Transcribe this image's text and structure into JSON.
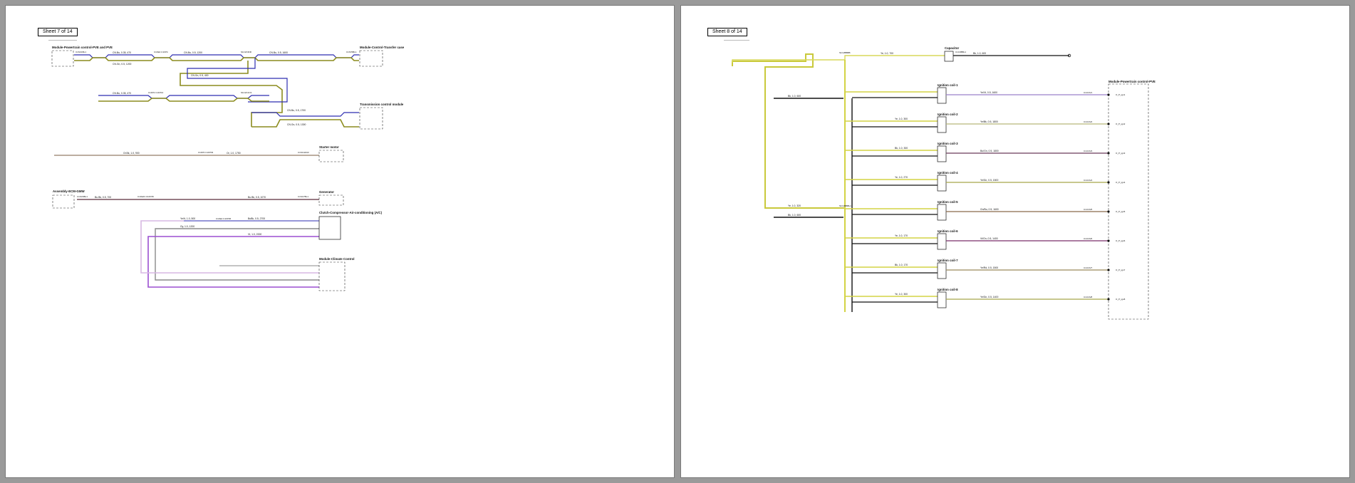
{
  "sheets": [
    {
      "label": "Sheet 7 of 14"
    },
    {
      "label": "Sheet 8 of 14"
    }
  ],
  "sheet7": {
    "components": {
      "pcm": "Module-Powertrain control-PVE and PVE",
      "transfer": "Module-Control-Transfer case",
      "tcm": "Transmission control module",
      "starter": "Starter motor",
      "assembly": "Assembly-ECM-GMW",
      "generator": "Generator",
      "clutch": "Clutch-Compressor-Air-conditioning (A/C)",
      "climate": "Module-Climate Control"
    },
    "wires": {
      "w1": "CN.Bu, 0.35, 470",
      "w2": "CN.Bu, 0.5, 1200",
      "w3": "CN.Bu, 0.5, 1600",
      "w4": "CN.Gn, 0.5, 1200",
      "w5": "CN.Gn, 0.5, 400",
      "w6": "CN.Bu, 0.35, 470",
      "w7": "CN.Bu, 0.5, 1700",
      "w8": "CN.Gn, 0.5, 1300",
      "w9": "Or.Bk, 1.0, 900",
      "w10": "Or, 1.0, 1750",
      "w11": "Bu.Bk, 0.5, 700",
      "w12": "Bu.Bk, 0.5, 1070",
      "w13": "YeVt, 1.0, 500",
      "w14": "BuBk, 0.5, 2700",
      "w15": "Vt, 1.0, 2000",
      "w16": "Gy, 1.0, 1200"
    },
    "pins": {
      "p1": "C1SC1BL1",
      "p2": "C1FE4 C1FP4",
      "p3": "S1C2C3NF",
      "p4": "C1S70BL1",
      "p5": "C1FP2 C1FP13",
      "p6": "S1C2C1C3",
      "p7": "C1FP4 C1FP33",
      "p8": "C1SC4AN3",
      "p9": "C1SC6BL1",
      "p10": "C1FE43 C1FP45",
      "p11": "C1SC7BL1",
      "p12": "C1FE2 C1FP45"
    }
  },
  "sheet8": {
    "components": {
      "capacitor": "Capacitor",
      "pcm": "Module-Powertrain control-PVE",
      "coils": [
        "Ignition coil-1",
        "Ignition coil-2",
        "Ignition coil-3",
        "Ignition coil-4",
        "Ignition coil-5",
        "Ignition coil-6",
        "Ignition coil-7",
        "Ignition coil-8"
      ]
    },
    "wires": {
      "feed": "Ye, 1.0, 320",
      "gnd": "Bk, 1.0, 600",
      "top": "Ye, 1.0, 700",
      "pins": [
        "Ye/Vt, 0.5, 1600",
        "Ye/Bk, 0.5, 1800",
        "Bu/Gn, 0.5, 1800",
        "Ye/Gn, 0.5, 1500",
        "Gn/Bu, 0.5, 1600",
        "Vt/Gn, 0.5, 1400",
        "Ye/Rd, 0.5, 1500",
        "Ye/Gn, 0.5, 1400"
      ],
      "branch": [
        "Ye, 1.0, 300",
        "Bk, 1.0, 300",
        "Ye, 1.0, 270",
        "Bk, 1.0, 270",
        "Ye, 1.0, 170",
        "Bk, 1.0, 170"
      ]
    },
    "pins": {
      "splice1": "S1C2BBBB",
      "splice2": "S1C2BBBL1",
      "cap": "C1C3BBL1",
      "pcmpins": [
        "C1C1S/1",
        "C1C1S/2",
        "C1C1S/3",
        "C1C1S/4",
        "C1C1S/5",
        "C1C1S/6",
        "C1C1S/7",
        "C1C1S/8"
      ],
      "signals": [
        "O_P_ign1",
        "O_P_ign2",
        "O_P_ign3",
        "O_P_ign4",
        "O_P_ign5",
        "O_P_ign6",
        "O_P_ign7",
        "O_P_ign8"
      ]
    }
  }
}
